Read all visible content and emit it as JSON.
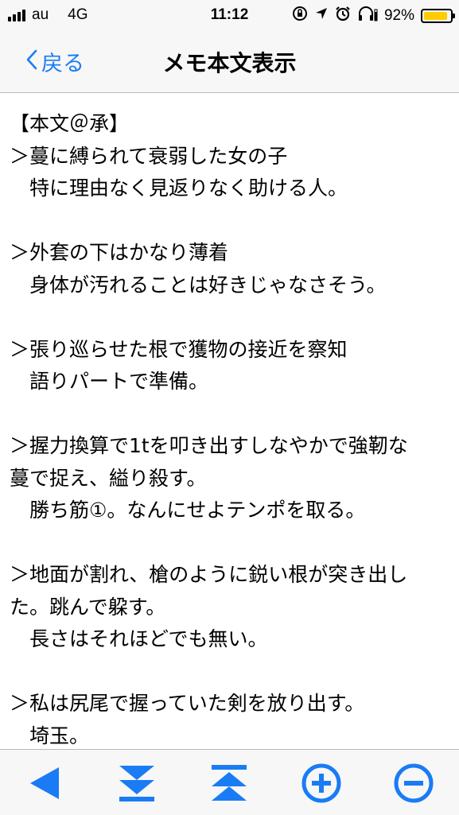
{
  "status_bar": {
    "carrier": "au",
    "network": "4G",
    "time": "11:12",
    "battery": "92%",
    "battery_level": 0.92,
    "icons": [
      "signal-icon",
      "rotation-lock-icon",
      "location-icon",
      "alarm-icon",
      "headphones-icon",
      "battery-icon"
    ]
  },
  "nav": {
    "back_label": "戻る",
    "title": "メモ本文表示"
  },
  "memo": {
    "body": "【本文＠承】\n＞蔓に縛られて衰弱した女の子\n　特に理由なく見返りなく助ける人。\n\n＞外套の下はかなり薄着\n　身体が汚れることは好きじゃなさそう。\n\n＞張り巡らせた根で獲物の接近を察知\n　語りパートで準備。\n\n＞握力換算で1tを叩き出すしなやかで強靭な\n蔓で捉え、縊り殺す。\n　勝ち筋①。なんにせよテンポを取る。\n\n＞地面が割れ、槍のように鋭い根が突き出し\nた。跳んで躱す。\n　長さはそれほどでも無い。\n\n＞私は尻尾で握っていた剣を放り出す。\n　埼玉。"
  },
  "toolbar": {
    "buttons": [
      "back-triangle-icon",
      "scroll-bottom-icon",
      "scroll-top-icon",
      "zoom-in-icon",
      "zoom-out-icon"
    ],
    "accent": "#1a7cf4"
  }
}
